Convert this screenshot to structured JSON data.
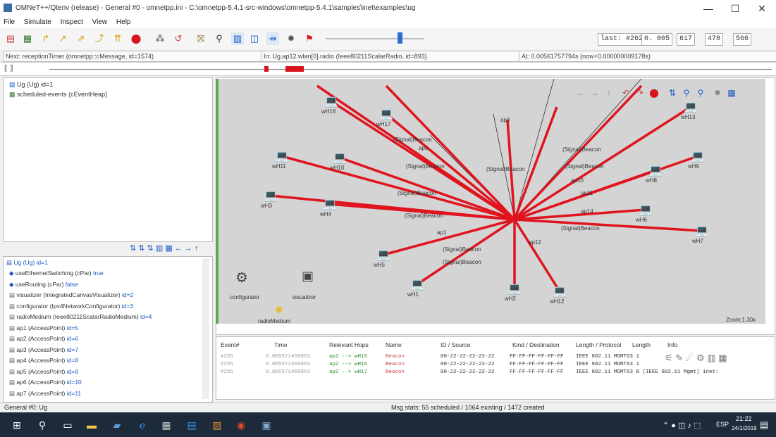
{
  "window": {
    "title": "OMNeT++/Qtenv (release) - General #0 - omnetpp.ini - C:\\omnetpp-5.4.1-src-windows\\omnetpp-5.4.1\\samples\\inet\\examples\\ug",
    "minimize": "—",
    "maximize": "☐",
    "close": "✕"
  },
  "menu": {
    "items": [
      "File",
      "Simulate",
      "Inspect",
      "View",
      "Help"
    ]
  },
  "toolbar": {
    "event_counter": "last: #262",
    "time_s": "0. 005",
    "time_ms": "617",
    "time_us": "478",
    "time_ns": "566"
  },
  "status": {
    "next_event": "Next: receptionTimer (omnetpp::cMessage, id=1574)",
    "in_module": "In: Ug.ap12.wlan[0].radio (Ieee80211ScalarRadio, id=893)",
    "at_time": "At: 0.00561757794s (now+0.000000009178s)"
  },
  "tree": {
    "root": "Ug (Ug) id=1",
    "scheduled": "scheduled-events (cEventHeap)"
  },
  "inspector": {
    "root": "Ug (Ug) id=1",
    "items": [
      {
        "label": "useEthernetSwitching (cPar)",
        "value": "true",
        "icon": "param-icon"
      },
      {
        "label": "useRouting (cPar)",
        "value": "false",
        "icon": "param-icon"
      },
      {
        "label": "visualizer (IntegratedCanvasVisualizer)",
        "value": "id=2",
        "icon": "module-icon"
      },
      {
        "label": "configurator (Ipv4NetworkConfigurator)",
        "value": "id=3",
        "icon": "module-icon"
      },
      {
        "label": "radioMedium (Ieee80211ScalarRadioMedium)",
        "value": "id=4",
        "icon": "module-icon"
      },
      {
        "label": "ap1 (AccessPoint)",
        "value": "id=5",
        "icon": "module-icon"
      },
      {
        "label": "ap2 (AccessPoint)",
        "value": "id=6",
        "icon": "module-icon"
      },
      {
        "label": "ap3 (AccessPoint)",
        "value": "id=7",
        "icon": "module-icon"
      },
      {
        "label": "ap4 (AccessPoint)",
        "value": "id=8",
        "icon": "module-icon"
      },
      {
        "label": "ap5 (AccessPoint)",
        "value": "id=9",
        "icon": "module-icon"
      },
      {
        "label": "ap6 (AccessPoint)",
        "value": "id=10",
        "icon": "module-icon"
      },
      {
        "label": "ap7 (AccessPoint)",
        "value": "id=11",
        "icon": "module-icon"
      }
    ]
  },
  "canvas": {
    "hosts": [
      {
        "name": "wH16"
      },
      {
        "name": "wH17"
      },
      {
        "name": "wH11"
      },
      {
        "name": "wH10"
      },
      {
        "name": "wH3"
      },
      {
        "name": "wH4"
      },
      {
        "name": "wH13"
      },
      {
        "name": "wH8"
      },
      {
        "name": "wH9"
      },
      {
        "name": "wH6"
      },
      {
        "name": "wH7"
      },
      {
        "name": "wH5"
      },
      {
        "name": "wH1"
      },
      {
        "name": "wH2"
      },
      {
        "name": "wH12"
      }
    ],
    "signal_labels": [
      "(Signal)Beacon",
      "(Signal)Beacon",
      "(Signal)Beacon",
      "(Signal)Beacon",
      "(Signal)Beacon",
      "(Signal)Beacon",
      "(Signal)Beacon",
      "(Signal)Beacon",
      "(Signal)Beacon",
      "(Signal)Beacon"
    ],
    "ap_labels": [
      "ap3",
      "ap5",
      "ap10",
      "ap11",
      "ap14",
      "ap1",
      "ap12"
    ],
    "configurator": "configurator",
    "visualizer": "visualizer",
    "radio_medium": "radioMedium",
    "zoom": "Zoom:1.30x"
  },
  "log": {
    "headers": [
      "Event#",
      "Time",
      "Relevant Hops",
      "Name",
      "ID / Source",
      "Kind / Destination",
      "Length / Protocol",
      "Length",
      "Info"
    ],
    "rows": [
      {
        "event": "#255",
        "time": "0.005571460053",
        "hops": "ap2 --> wH15",
        "name": "Beacon",
        "src": "00-22-22-22-22-22",
        "dst": "FF-FF-FF-FF-FF-FF",
        "info": "IEEE 802.11 MGMT63 1"
      },
      {
        "event": "#255",
        "time": "0.005571460053",
        "hops": "ap2 --> wH16",
        "name": "Beacon",
        "src": "00-22-22-22-22-22",
        "dst": "FF-FF-FF-FF-FF-FF",
        "info": "IEEE 802.11 MGMT63 1"
      },
      {
        "event": "#255",
        "time": "0.005571460053",
        "hops": "ap2 --> wH17",
        "name": "Beacon",
        "src": "00-22-22-22-22-22",
        "dst": "FF-FF-FF-FF-FF-FF",
        "info": "IEEE 802.11 MGMT63 B (IEEE 802.11 Mgmt) inet:"
      }
    ]
  },
  "bottom": {
    "left": "General #0: Ug",
    "msgstats": "Msg stats: 55 scheduled / 1064 existing / 1472 created"
  },
  "taskbar": {
    "time": "21:22",
    "date": "24/1/2019",
    "lang": "ESP"
  },
  "colors": {
    "signal_line": "#e0141e",
    "canvas_bg": "#d4d4d4",
    "taskbar_bg": "#1c2a3a"
  }
}
